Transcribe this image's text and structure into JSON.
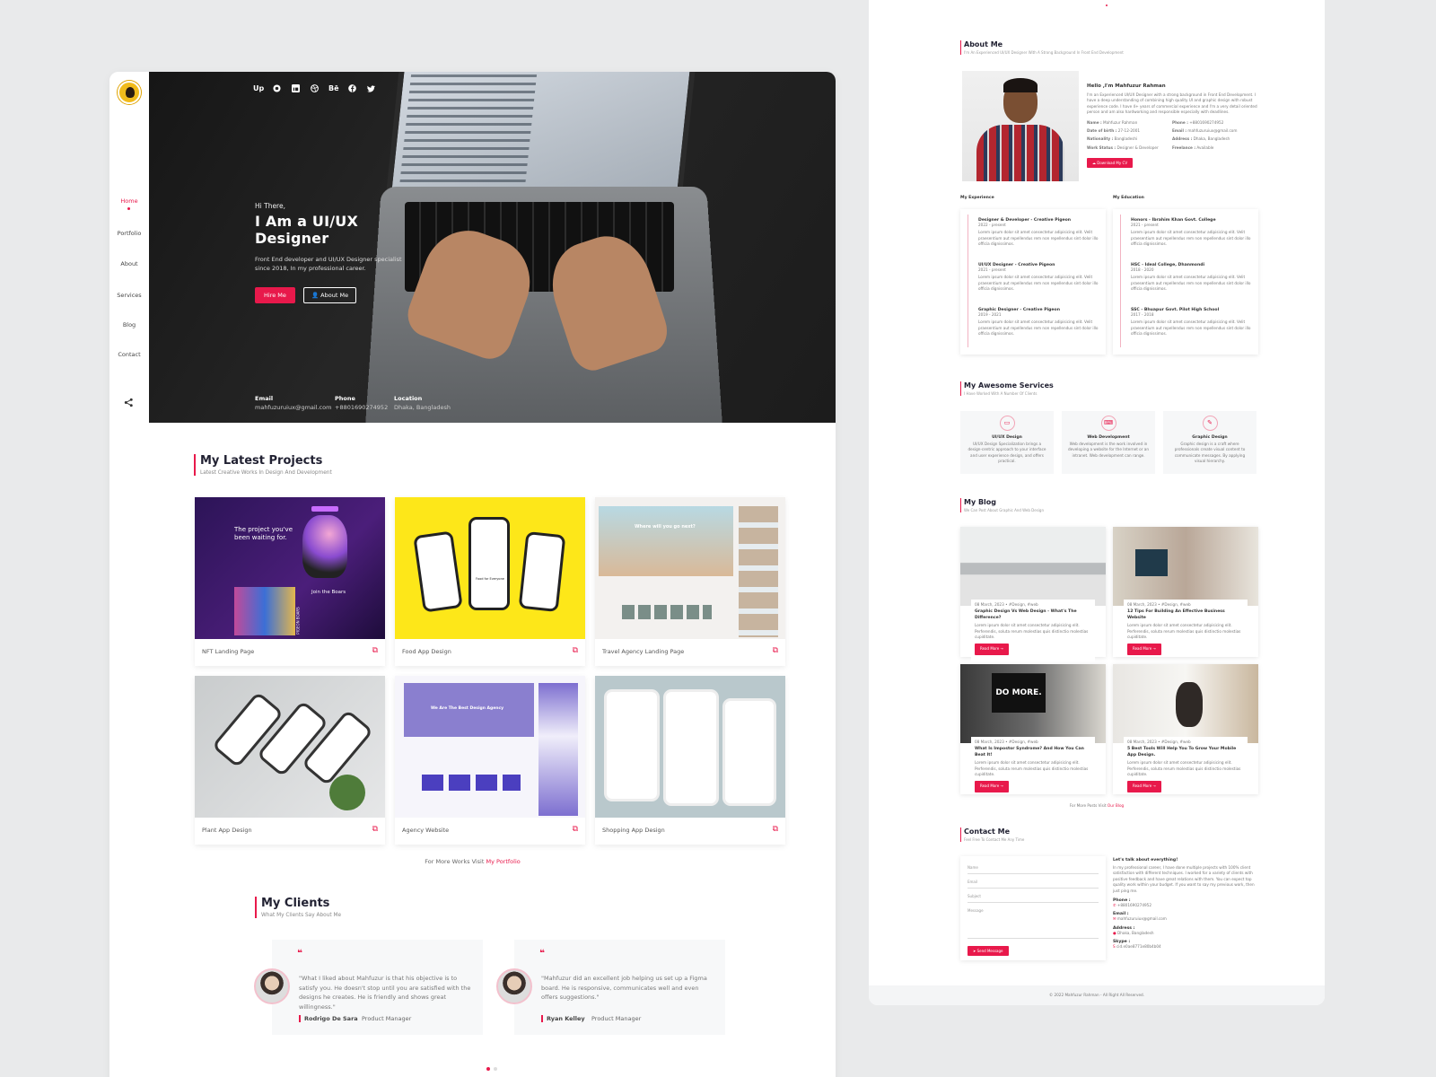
{
  "colors": {
    "accent": "#e8194b",
    "logo": "#f1bb1c"
  },
  "nav": {
    "items": [
      "Home",
      "Portfolio",
      "About",
      "Services",
      "Blog",
      "Contact"
    ],
    "active": "Home"
  },
  "social": [
    "Up",
    "github-icon",
    "linkedin-icon",
    "dribbble-icon",
    "Bē",
    "facebook-icon",
    "twitter-icon"
  ],
  "hero": {
    "greeting": "Hi There,",
    "title": "I Am a UI/UX Designer",
    "description": "Front End developer and UI/UX Designer specialist since 2018, In my professional career.",
    "hire_btn": "Hire Me",
    "about_btn": "About Me",
    "email_label": "Email",
    "email": "mahfuzuruiux@gmail.com",
    "phone_label": "Phone",
    "phone": "+8801690274952",
    "location_label": "Location",
    "location": "Dhaka, Bangladesh"
  },
  "projects": {
    "title": "My Latest Projects",
    "subtitle": "Latest Creative Works In Design And Development",
    "items": [
      "NFT Landing Page",
      "Food App Design",
      "Travel Agency Landing Page",
      "Plant App Design",
      "Agency Website",
      "Shopping App Design"
    ],
    "nft_headline": "The project you've been waiting for.",
    "nft_join": "Join the Boars",
    "nft_side": "PIGEON BOARS",
    "food_headline": "Food for Everyone",
    "travel_headline": "Where will you go next?",
    "agency_headline": "We Are The Best Design Agency",
    "more_prefix": "For More Works Visit ",
    "more_link": "My Portfolio"
  },
  "clients": {
    "title": "My Clients",
    "subtitle": "What My Clients Say About Me",
    "items": [
      {
        "quote": "\"What I liked about Mahfuzur is that his objective is to satisfy you. He doesn't stop until you are satisfied with the designs he creates. He is friendly and shows great willingness.\"",
        "name": "Rodrigo De Sara",
        "role": "Product Manager"
      },
      {
        "quote": "\"Mahfuzur did an excellent job helping us set up a Figma board. He is responsive, communicates well and even offers suggestions.\"",
        "name": "Ryan Kelley",
        "role": "Product Manager"
      }
    ]
  },
  "about": {
    "title": "About Me",
    "subtitle": "I'm An Experienced UI/UX Designer With A Strong Background In Front End Development",
    "hello": "Hello ,I'm Mahfuzur Rahman",
    "bio": "I'm an Experienced UI/UX Designer with a strong background in Front End Development. I have a deep understanding of combining high quality UI and graphic design with robust experience code. I have 4+ years of commercial experience and I'm a very detail oriented person and am also hardworking and responsible especially with deadlines.",
    "fields": [
      {
        "k": "Name :",
        "v": "Mahfuzur Rahman"
      },
      {
        "k": "Phone :",
        "v": "+8801690274952"
      },
      {
        "k": "Date of birth :",
        "v": "27-12-2001"
      },
      {
        "k": "Email :",
        "v": "mahfuzuruiux@gmail.com"
      },
      {
        "k": "Nationality :",
        "v": "Bangladeshi"
      },
      {
        "k": "Address :",
        "v": "Dhaka, Bangladesh"
      },
      {
        "k": "Work Status :",
        "v": "Designer & Developer"
      },
      {
        "k": "Freelance :",
        "v": "Available"
      }
    ],
    "cv_btn": "Download My CV"
  },
  "experience": {
    "title": "My Experience",
    "items": [
      {
        "t": "Designer & Developer - Creative Pigeon",
        "d": "2022 - present"
      },
      {
        "t": "UI/UX Designer - Creative Pigeon",
        "d": "2021 - present"
      },
      {
        "t": "Graphic Designer - Creative Pigeon",
        "d": "2019 - 2021"
      }
    ]
  },
  "education": {
    "title": "My Education",
    "items": [
      {
        "t": "Honors - Ibrahim Khan Govt. College",
        "d": "2021 - present"
      },
      {
        "t": "HSC - Ideal College, Dhanmondi",
        "d": "2018 - 2020"
      },
      {
        "t": "SSC - Bhuapur Govt. Pilot High School",
        "d": "2017 - 2018"
      }
    ]
  },
  "lorem": "Lorem ipsum dolor sit amet consectetur adipisicing elit. Velit praesentium aut repellendus rem non repellendus sint dolor illo officia dignissimos.",
  "services": {
    "title": "My Awesome Services",
    "subtitle": "I Have Worked With A Number Of Clients",
    "items": [
      {
        "name": "UI/UX Design",
        "desc": "UI/UX Design Specialization brings a design-centric approach to your interface and user experience design, and offers practical."
      },
      {
        "name": "Web Development",
        "desc": "Web development is the work involved in developing a website for the Internet or an intranet. Web development can range."
      },
      {
        "name": "Graphic Design",
        "desc": "Graphic design is a craft where professionals create visual content to communicate messages. By applying visual hierarchy."
      }
    ]
  },
  "blog": {
    "title": "My Blog",
    "subtitle": "We Can Post About Graphic And Web Design",
    "items": [
      {
        "meta": "08 March, 2023  •  #Design, #web",
        "title": "Graphic Design Vs Web Design - What's The Difference?"
      },
      {
        "meta": "08 March, 2023  •  #Design, #web",
        "title": "12 Tips For Building An Effective Business Website"
      },
      {
        "meta": "08 March, 2023  •  #Design, #web",
        "title": "What Is Impostor Syndrome? And How You Can Beat It!"
      },
      {
        "meta": "08 March, 2023  •  #Design, #web",
        "title": "5 Best Tools Will Help You To Grow Your Mobile App Design."
      }
    ],
    "excerpt": "Lorem ipsum dolor sit amet consectetur adipisicing elit. Perferendis, soluta rerum molestias quis distinctio molestias cupiditate.",
    "read_more": "Read More  →",
    "more_prefix": "For More Posts Visit ",
    "more_link": "Our Blog"
  },
  "contact": {
    "title": "Contact Me",
    "subtitle": "Feel Free To Contact Me Any Time",
    "fields": [
      "Name",
      "Email",
      "Subject",
      "Message"
    ],
    "send_btn": "Send Message",
    "talk_title": "Let's talk about everything!",
    "talk_text": "In my professional career, I have done multiple projects with 100% client satisfaction with different techniques. I worked for a variety of clients with positive feedback and have great relations with them. You can expect top quality work within your budget. If you want to say my previous work, then just ping me.",
    "phone_label": "Phone :",
    "phone": "+8801690274952",
    "email_label": "Email :",
    "email": "mahfuzuruiux@gmail.com",
    "address_label": "Address :",
    "address": "Dhaka, Bangladesh",
    "skype_label": "Skype :",
    "skype": "cid.e0ae8771e80b4b04"
  },
  "footer": "© 2022 Mahfuzur Rahman - All Right All Reserved."
}
